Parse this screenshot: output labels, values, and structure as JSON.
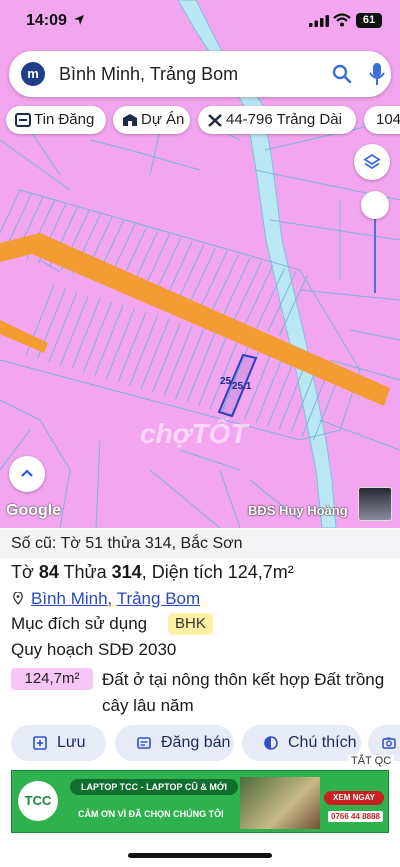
{
  "status_bar": {
    "time": "14:09",
    "battery": "61"
  },
  "search": {
    "avatar_letter": "m",
    "query": "Bình Minh, Trảng Bom"
  },
  "chips": [
    {
      "label": "Tin Đăng",
      "icon": "listing-icon"
    },
    {
      "label": "Dự Án",
      "icon": "building-icon"
    },
    {
      "label": "44-796 Trảng Dài",
      "icon": "tools-icon"
    },
    {
      "label": "104"
    }
  ],
  "map": {
    "watermark": "chợTỐT",
    "lot_labels": [
      "25",
      "25.1"
    ],
    "attribution": "Google",
    "agent_name": "BĐS Huy Hoàng",
    "colors": {
      "land": "#f3a6f0",
      "road": "#f39c34",
      "parcel_line": "#6fa8dc",
      "river": "#b8e6f2",
      "highlight": "#2b3fbf"
    }
  },
  "info": {
    "old_number": "Số cũ: Tờ 51 thửa 314, Bắc Sơn",
    "title_sheet_label": "Tờ",
    "title_sheet_value": "84",
    "title_plot_label": "Thửa",
    "title_plot_value": "314",
    "title_area_text": ", Diện tích 124,7m²",
    "ward": "Bình Minh",
    "addr_sep": ", ",
    "district": "Trảng Bom",
    "purpose_label": "Mục đích sử dụng",
    "purpose_code": "BHK",
    "plan_label": "Quy hoạch SDĐ 2030",
    "area_badge": "124,7m²",
    "area_desc": "Đất ở tại nông thôn kết hợp Đất trồng cây lâu năm"
  },
  "actions": [
    {
      "label": "Lưu",
      "icon": "bookmark-add-icon"
    },
    {
      "label": "Đăng bán",
      "icon": "post-icon"
    },
    {
      "label": "Chú thích",
      "icon": "legend-icon"
    },
    {
      "label": "",
      "icon": "camera-icon"
    }
  ],
  "ad": {
    "tag": "TẮT QC",
    "logo": "TCC",
    "headline": "LAPTOP TCC - LAPTOP CŨ & MỚI",
    "slogan": "CẢM ƠN VÌ ĐÃ CHỌN CHÚNG TÔI",
    "cta": "XEM NGAY",
    "phone": "0766 44 8888"
  }
}
